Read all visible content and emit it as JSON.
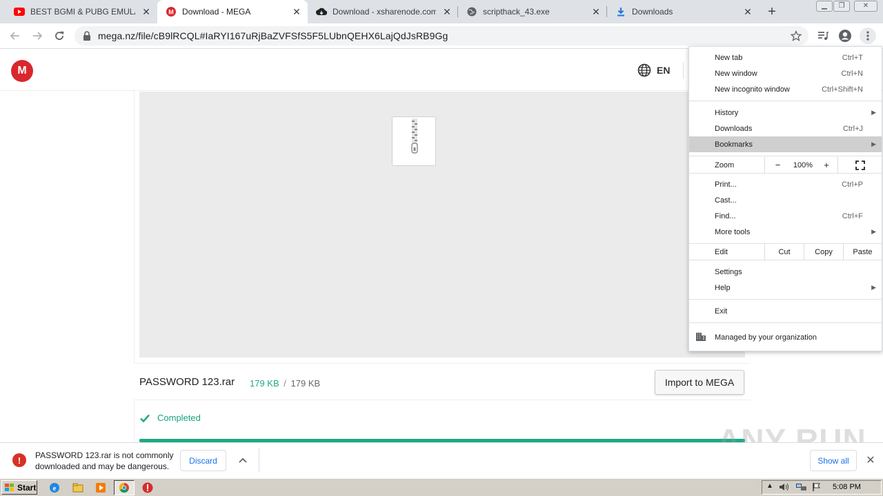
{
  "tabs": [
    {
      "title": "BEST BGMI & PUBG EMULATOR F",
      "icon": "youtube-icon",
      "active": false
    },
    {
      "title": "Download - MEGA",
      "icon": "mega-icon",
      "active": true
    },
    {
      "title": "Download - xsharenode.com",
      "icon": "cloud-download-icon",
      "active": false
    },
    {
      "title": "scripthack_43.exe",
      "icon": "globe-icon",
      "active": false
    },
    {
      "title": "Downloads",
      "icon": "download-arrow-icon",
      "active": false
    }
  ],
  "omnibox": {
    "url": "mega.nz/file/cB9lRCQL#IaRYI167uRjBaZVFSfS5F5LUbnQEHX6LajQdJsRB9Gg"
  },
  "mega": {
    "logo_letter": "M",
    "language": "EN",
    "file_name": "PASSWORD 123.rar",
    "downloaded": "179 KB",
    "size_sep": "/",
    "total": "179 KB",
    "import_label": "Import to MEGA",
    "status": "Completed",
    "progress": 1.0
  },
  "menu": {
    "new_tab": "New tab",
    "new_tab_sc": "Ctrl+T",
    "new_window": "New window",
    "new_window_sc": "Ctrl+N",
    "incognito": "New incognito window",
    "incognito_sc": "Ctrl+Shift+N",
    "history": "History",
    "downloads": "Downloads",
    "downloads_sc": "Ctrl+J",
    "bookmarks": "Bookmarks",
    "zoom": "Zoom",
    "zoom_minus": "−",
    "zoom_level": "100%",
    "zoom_plus": "+",
    "print": "Print...",
    "print_sc": "Ctrl+P",
    "cast": "Cast...",
    "find": "Find...",
    "find_sc": "Ctrl+F",
    "more_tools": "More tools",
    "edit": "Edit",
    "cut": "Cut",
    "copy": "Copy",
    "paste": "Paste",
    "settings": "Settings",
    "help": "Help",
    "exit": "Exit",
    "managed": "Managed by your organization"
  },
  "download_bar": {
    "warning": "PASSWORD 123.rar is not commonly downloaded and may be dangerous.",
    "discard": "Discard",
    "show_all": "Show all"
  },
  "watermark": "ANY RUN",
  "taskbar": {
    "start": "Start",
    "clock": "5:08 PM"
  },
  "colors": {
    "mega_red": "#d9272e",
    "mega_green": "#1ea886",
    "link_blue": "#1a73e8"
  }
}
